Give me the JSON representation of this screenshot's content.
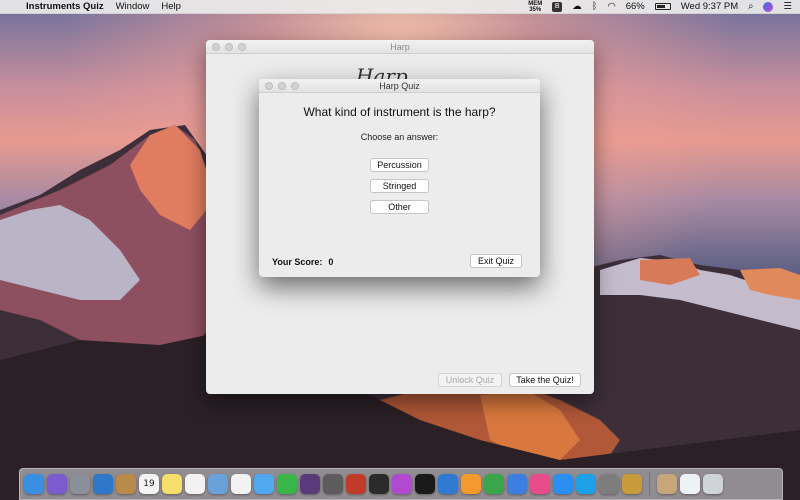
{
  "menubar": {
    "app_name": "Instruments Quiz",
    "menus": [
      "Window",
      "Help"
    ],
    "mem_label": "MEM",
    "mem_value": "35%",
    "battery": "66%",
    "battery_level": 0.66,
    "clock": "Wed 9:37 PM"
  },
  "main_window": {
    "title": "Harp",
    "logo_text": "Harp",
    "unlock_button": "Unlock Quiz",
    "take_quiz_button": "Take the Quiz!"
  },
  "quiz_window": {
    "title": "Harp Quiz",
    "question": "What kind of instrument is the harp?",
    "prompt": "Choose an answer:",
    "answers": [
      "Percussion",
      "Stringed",
      "Other"
    ],
    "score_label": "Your Score:",
    "score_value": "0",
    "exit_button": "Exit Quiz"
  },
  "dock": {
    "calendar_day": "19",
    "icons": [
      {
        "name": "finder-icon",
        "color": "#3b8fe0"
      },
      {
        "name": "siri-icon",
        "color": "#7a5ccf"
      },
      {
        "name": "launchpad-icon",
        "color": "#8a8f98"
      },
      {
        "name": "preview-icon",
        "color": "#2f78c8"
      },
      {
        "name": "notefile-icon",
        "color": "#b98a4a"
      },
      {
        "name": "calendar-icon",
        "color": "#f4f4f4"
      },
      {
        "name": "notes-icon",
        "color": "#f6de6a"
      },
      {
        "name": "reminders-icon",
        "color": "#f2f2f2"
      },
      {
        "name": "preview-app-icon",
        "color": "#6aa1d6"
      },
      {
        "name": "photos-icon",
        "color": "#f2f2f2"
      },
      {
        "name": "messages-icon",
        "color": "#52a8f0"
      },
      {
        "name": "facetime-icon",
        "color": "#39b54a"
      },
      {
        "name": "music-creator-icon",
        "color": "#5a3a7a"
      },
      {
        "name": "disk-utility-icon",
        "color": "#5c5c5c"
      },
      {
        "name": "photo-booth-icon",
        "color": "#c23b2a"
      },
      {
        "name": "final-cut-icon",
        "color": "#2b2b2b"
      },
      {
        "name": "motion-icon",
        "color": "#b04ad0"
      },
      {
        "name": "terminal-icon",
        "color": "#1a1a1a"
      },
      {
        "name": "xcode-icon",
        "color": "#2e7bd1"
      },
      {
        "name": "pages-icon",
        "color": "#f29a2e"
      },
      {
        "name": "numbers-icon",
        "color": "#3aa64a"
      },
      {
        "name": "keynote-icon",
        "color": "#3c7fe0"
      },
      {
        "name": "itunes-icon",
        "color": "#e84c8a"
      },
      {
        "name": "app-store-icon",
        "color": "#2a8ff0"
      },
      {
        "name": "skype-icon",
        "color": "#1ea0e6"
      },
      {
        "name": "system-preferences-icon",
        "color": "#7d7d7d"
      },
      {
        "name": "instruments-quiz-icon",
        "color": "#c99a3a"
      },
      {
        "name": "documents-folder-icon",
        "color": "#c7a67a"
      },
      {
        "name": "downloads-icon",
        "color": "#eef2f6"
      },
      {
        "name": "trash-icon",
        "color": "#d0d4d8"
      }
    ]
  }
}
